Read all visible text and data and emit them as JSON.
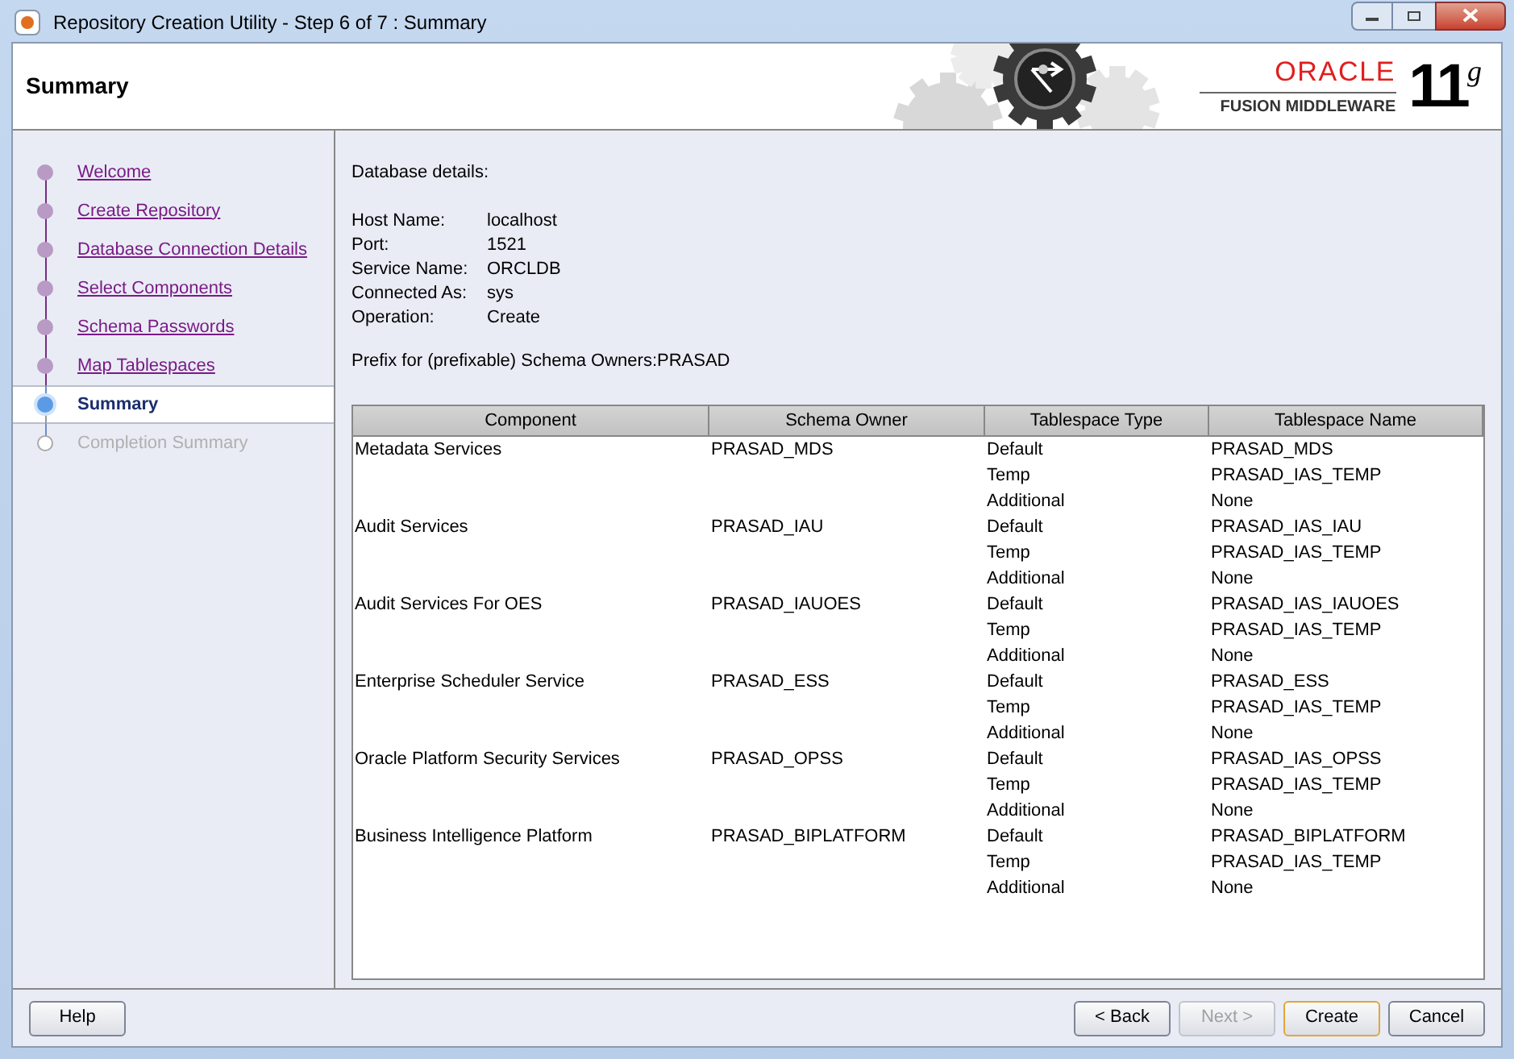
{
  "window": {
    "title": "Repository Creation Utility - Step 6 of 7 : Summary"
  },
  "header": {
    "title": "Summary",
    "brand": "ORACLE",
    "product": "FUSION MIDDLEWARE",
    "version": "11",
    "version_suffix": "g"
  },
  "steps": [
    {
      "label": "Welcome",
      "selected": false,
      "disabled": false
    },
    {
      "label": "Create Repository",
      "selected": false,
      "disabled": false
    },
    {
      "label": "Database Connection Details",
      "selected": false,
      "disabled": false
    },
    {
      "label": "Select Components",
      "selected": false,
      "disabled": false
    },
    {
      "label": "Schema Passwords",
      "selected": false,
      "disabled": false
    },
    {
      "label": "Map Tablespaces",
      "selected": false,
      "disabled": false
    },
    {
      "label": "Summary",
      "selected": true,
      "disabled": false
    },
    {
      "label": "Completion Summary",
      "selected": false,
      "disabled": true
    }
  ],
  "details": {
    "heading": "Database details:",
    "fields": [
      {
        "label": "Host Name:",
        "value": "localhost"
      },
      {
        "label": "Port:",
        "value": "1521"
      },
      {
        "label": "Service Name:",
        "value": "ORCLDB"
      },
      {
        "label": "Connected As:",
        "value": "sys"
      },
      {
        "label": "Operation:",
        "value": "Create"
      }
    ],
    "prefix": "Prefix for (prefixable) Schema Owners:PRASAD"
  },
  "table": {
    "columns": [
      "Component",
      "Schema Owner",
      "Tablespace Type",
      "Tablespace Name"
    ],
    "rows": [
      {
        "component": "Metadata Services",
        "owner": "PRASAD_MDS",
        "tablespaces": [
          {
            "type": "Default",
            "name": "PRASAD_MDS"
          },
          {
            "type": "Temp",
            "name": "PRASAD_IAS_TEMP"
          },
          {
            "type": "Additional",
            "name": "None"
          }
        ]
      },
      {
        "component": "Audit Services",
        "owner": "PRASAD_IAU",
        "tablespaces": [
          {
            "type": "Default",
            "name": "PRASAD_IAS_IAU"
          },
          {
            "type": "Temp",
            "name": "PRASAD_IAS_TEMP"
          },
          {
            "type": "Additional",
            "name": "None"
          }
        ]
      },
      {
        "component": "Audit Services For OES",
        "owner": "PRASAD_IAUOES",
        "tablespaces": [
          {
            "type": "Default",
            "name": "PRASAD_IAS_IAUOES"
          },
          {
            "type": "Temp",
            "name": "PRASAD_IAS_TEMP"
          },
          {
            "type": "Additional",
            "name": "None"
          }
        ]
      },
      {
        "component": "Enterprise Scheduler Service",
        "owner": "PRASAD_ESS",
        "tablespaces": [
          {
            "type": "Default",
            "name": "PRASAD_ESS"
          },
          {
            "type": "Temp",
            "name": "PRASAD_IAS_TEMP"
          },
          {
            "type": "Additional",
            "name": "None"
          }
        ]
      },
      {
        "component": "Oracle Platform Security Services",
        "owner": "PRASAD_OPSS",
        "tablespaces": [
          {
            "type": "Default",
            "name": "PRASAD_IAS_OPSS"
          },
          {
            "type": "Temp",
            "name": "PRASAD_IAS_TEMP"
          },
          {
            "type": "Additional",
            "name": "None"
          }
        ]
      },
      {
        "component": "Business Intelligence Platform",
        "owner": "PRASAD_BIPLATFORM",
        "tablespaces": [
          {
            "type": "Default",
            "name": "PRASAD_BIPLATFORM"
          },
          {
            "type": "Temp",
            "name": "PRASAD_IAS_TEMP"
          },
          {
            "type": "Additional",
            "name": "None"
          }
        ]
      }
    ]
  },
  "buttons": {
    "help": {
      "label": "Help",
      "disabled": false
    },
    "nav": [
      {
        "label": "< Back",
        "disabled": false,
        "default": false
      },
      {
        "label": "Next >",
        "disabled": true,
        "default": false
      },
      {
        "label": "Create",
        "disabled": false,
        "default": true
      },
      {
        "label": "Cancel",
        "disabled": false,
        "default": false
      }
    ]
  }
}
